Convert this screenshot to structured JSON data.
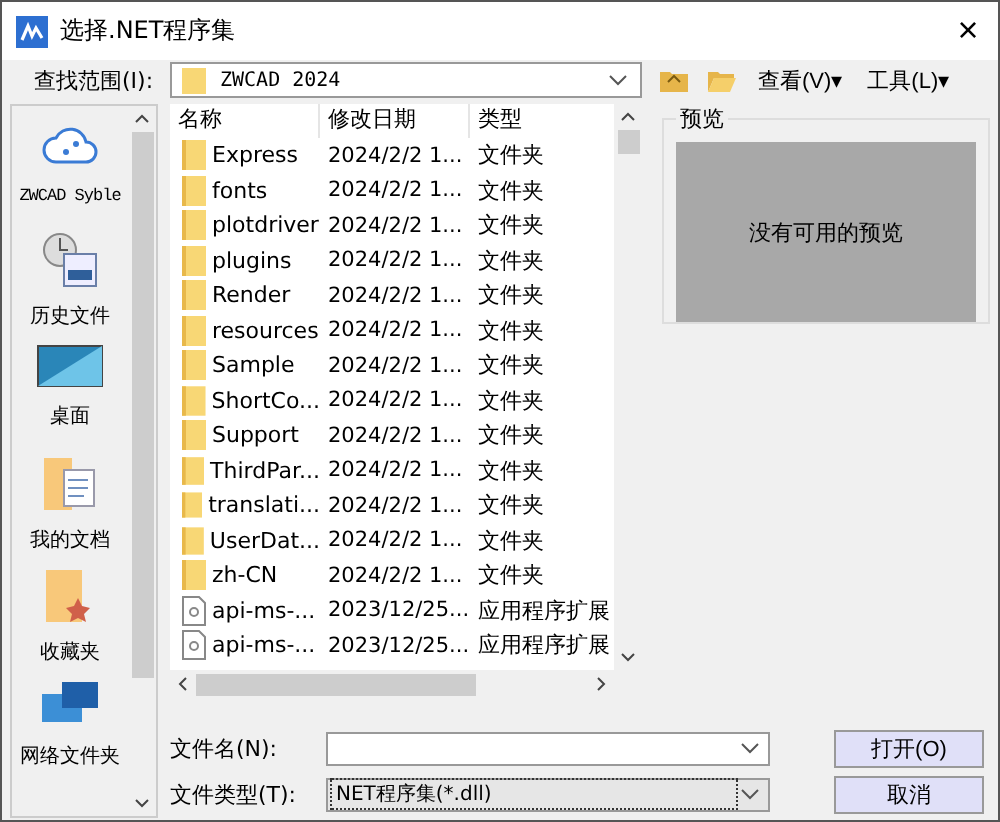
{
  "window": {
    "title": "选择.NET程序集",
    "close": "×"
  },
  "toolbar": {
    "look_in_label": "查找范围(I):",
    "location": "ZWCAD 2024",
    "view_menu": "查看(V)▾",
    "tools_menu": "工具(L)▾"
  },
  "places": [
    {
      "kind": "cloud",
      "label": "ZWCAD Syble"
    },
    {
      "kind": "history",
      "label": "历史文件"
    },
    {
      "kind": "desktop",
      "label": "桌面"
    },
    {
      "kind": "documents",
      "label": "我的文档"
    },
    {
      "kind": "favorites",
      "label": "收藏夹"
    },
    {
      "kind": "network",
      "label": "网络文件夹"
    }
  ],
  "table": {
    "columns": [
      "名称",
      "修改日期",
      "类型"
    ],
    "rows": [
      {
        "kind": "folder",
        "cells": [
          "Express",
          "2024/2/2 1...",
          "文件夹"
        ]
      },
      {
        "kind": "folder",
        "cells": [
          "fonts",
          "2024/2/2 1...",
          "文件夹"
        ]
      },
      {
        "kind": "folder",
        "cells": [
          "plotdriver",
          "2024/2/2 1...",
          "文件夹"
        ]
      },
      {
        "kind": "folder",
        "cells": [
          "plugins",
          "2024/2/2 1...",
          "文件夹"
        ]
      },
      {
        "kind": "folder",
        "cells": [
          "Render",
          "2024/2/2 1...",
          "文件夹"
        ]
      },
      {
        "kind": "folder",
        "cells": [
          "resources",
          "2024/2/2 1...",
          "文件夹"
        ]
      },
      {
        "kind": "folder",
        "cells": [
          "Sample",
          "2024/2/2 1...",
          "文件夹"
        ]
      },
      {
        "kind": "folder",
        "cells": [
          "ShortCo...",
          "2024/2/2 1...",
          "文件夹"
        ]
      },
      {
        "kind": "folder",
        "cells": [
          "Support",
          "2024/2/2 1...",
          "文件夹"
        ]
      },
      {
        "kind": "folder",
        "cells": [
          "ThirdPar...",
          "2024/2/2 1...",
          "文件夹"
        ]
      },
      {
        "kind": "folder",
        "cells": [
          "translati...",
          "2024/2/2 1...",
          "文件夹"
        ]
      },
      {
        "kind": "folder",
        "cells": [
          "UserDat...",
          "2024/2/2 1...",
          "文件夹"
        ]
      },
      {
        "kind": "folder",
        "cells": [
          "zh-CN",
          "2024/2/2 1...",
          "文件夹"
        ]
      },
      {
        "kind": "file",
        "cells": [
          "api-ms-...",
          "2023/12/25...",
          "应用程序扩展"
        ]
      },
      {
        "kind": "file",
        "cells": [
          "api-ms-...",
          "2023/12/25...",
          "应用程序扩展"
        ]
      }
    ]
  },
  "preview": {
    "title": "预览",
    "message": "没有可用的预览"
  },
  "file_name": {
    "label": "文件名(N):"
  },
  "file_type": {
    "label": "文件类型(T):",
    "value": "NET程序集(*.dll)"
  },
  "buttons": [
    "打开(O)",
    "取消"
  ]
}
